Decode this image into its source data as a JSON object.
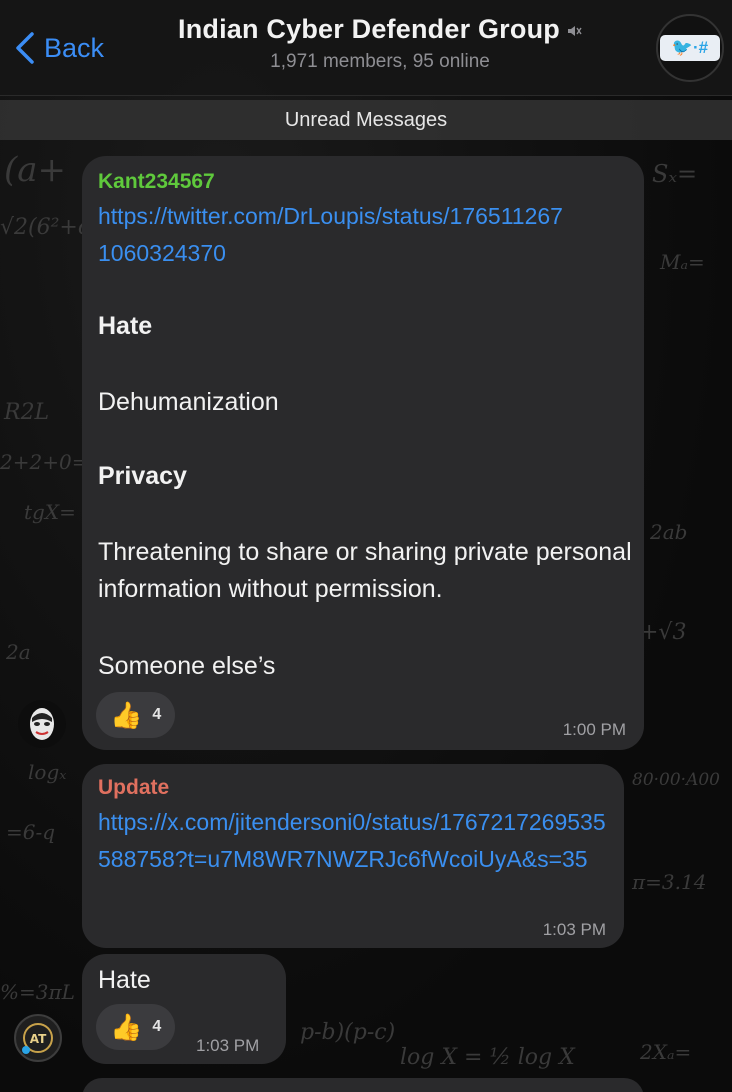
{
  "header": {
    "back_label": "Back",
    "title": "Indian Cyber Defender Group",
    "subtitle": "1,971 members, 95 online",
    "avatar_text": "🐦·#"
  },
  "banner": {
    "unread_label": "Unread Messages"
  },
  "messages": [
    {
      "sender": "Kant234567",
      "sender_color": "#5fc93c",
      "link": "https://twitter.com/DrLoupis/status/1765112671060324370",
      "lines": [
        "Hate",
        "Dehumanization",
        "Privacy",
        "Threatening to share or sharing private personal information without permission.",
        "Someone else’s"
      ],
      "reaction": {
        "emoji": "👍",
        "count": "4"
      },
      "time": "1:00 PM"
    },
    {
      "sender": "Update",
      "sender_color": "#e0705f",
      "link": "https://x.com/jitendersoni0/status/1767217269535588758?t=u7M8WR7NWZRJc6fWcoiUyA&s=35",
      "time": "1:03 PM"
    },
    {
      "text": "Hate",
      "reaction": {
        "emoji": "👍",
        "count": "4"
      },
      "time": "1:03 PM"
    }
  ],
  "colors": {
    "accent": "#3b8df5",
    "bubble": "#2a2a2c",
    "link": "#3a8ff0"
  }
}
